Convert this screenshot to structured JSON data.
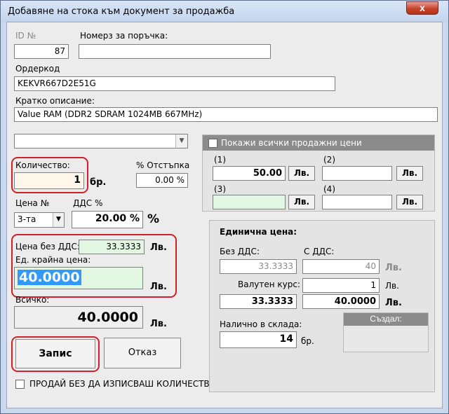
{
  "window": {
    "title": "Добавяне на стока към документ за продажба",
    "close_glyph": "x"
  },
  "form": {
    "id_label": "ID №",
    "id_value": "87",
    "order_label": "Номерз за поръчка:",
    "order_value": "",
    "ordercode_label": "Ордеркод",
    "ordercode_value": "KEKVR667D2E51G",
    "desc_label": "Кратко описание:",
    "desc_value": "Value RAM (DDR2 SDRAM 1024MB 667MHz)",
    "combo_value": "",
    "qty_label": "Количество:",
    "qty_value": "1",
    "qty_unit": "бр.",
    "discount_label": "% Отстъпка",
    "discount_value": "0.00 %",
    "price_no_label": "Цена №",
    "price_no_value": "3-та",
    "vat_label": "ДДС %",
    "vat_value": "20.00 %",
    "vat_sign": "%",
    "price_no_vat_label": "Цена без ДДС:",
    "price_no_vat_value": "33.3333",
    "currency": "Лв.",
    "final_price_label": "Ед. крайна цена:",
    "final_price_value": "40.0000",
    "total_label": "Всичко:",
    "total_value": "40.0000"
  },
  "prices_panel": {
    "checkbox_label": "Покажи всички продажни цени",
    "p1_label": "(1)",
    "p1_value": "50.00",
    "p2_label": "(2)",
    "p2_value": "",
    "p3_label": "(3)",
    "p3_value": "",
    "p4_label": "(4)",
    "p4_value": "",
    "currency": "Лв."
  },
  "unit_panel": {
    "title": "Единична цена:",
    "no_vat_label": "Без ДДС:",
    "with_vat_label": "С ДДС:",
    "no_vat_value": "33.3333",
    "with_vat_value": "40",
    "currency": "Лв.",
    "rate_label": "Валутен курс:",
    "rate_value": "1",
    "converted_no_vat": "33.3333",
    "converted_with_vat": "40.0000",
    "stock_label": "Налично в склада:",
    "stock_value": "14",
    "stock_unit": "бр.",
    "created_by_label": "Създал:",
    "created_by_value": ""
  },
  "buttons": {
    "save": "Запис",
    "cancel": "Отказ"
  },
  "footer": {
    "sell_without_stock_label": "ПРОДАЙ БЕЗ ДА ИЗПИСВАШ КОЛИЧЕСТВО ОТ СКЛАДА"
  },
  "colors": {
    "highlight": "#d0202a",
    "selection": "#3399ff"
  }
}
